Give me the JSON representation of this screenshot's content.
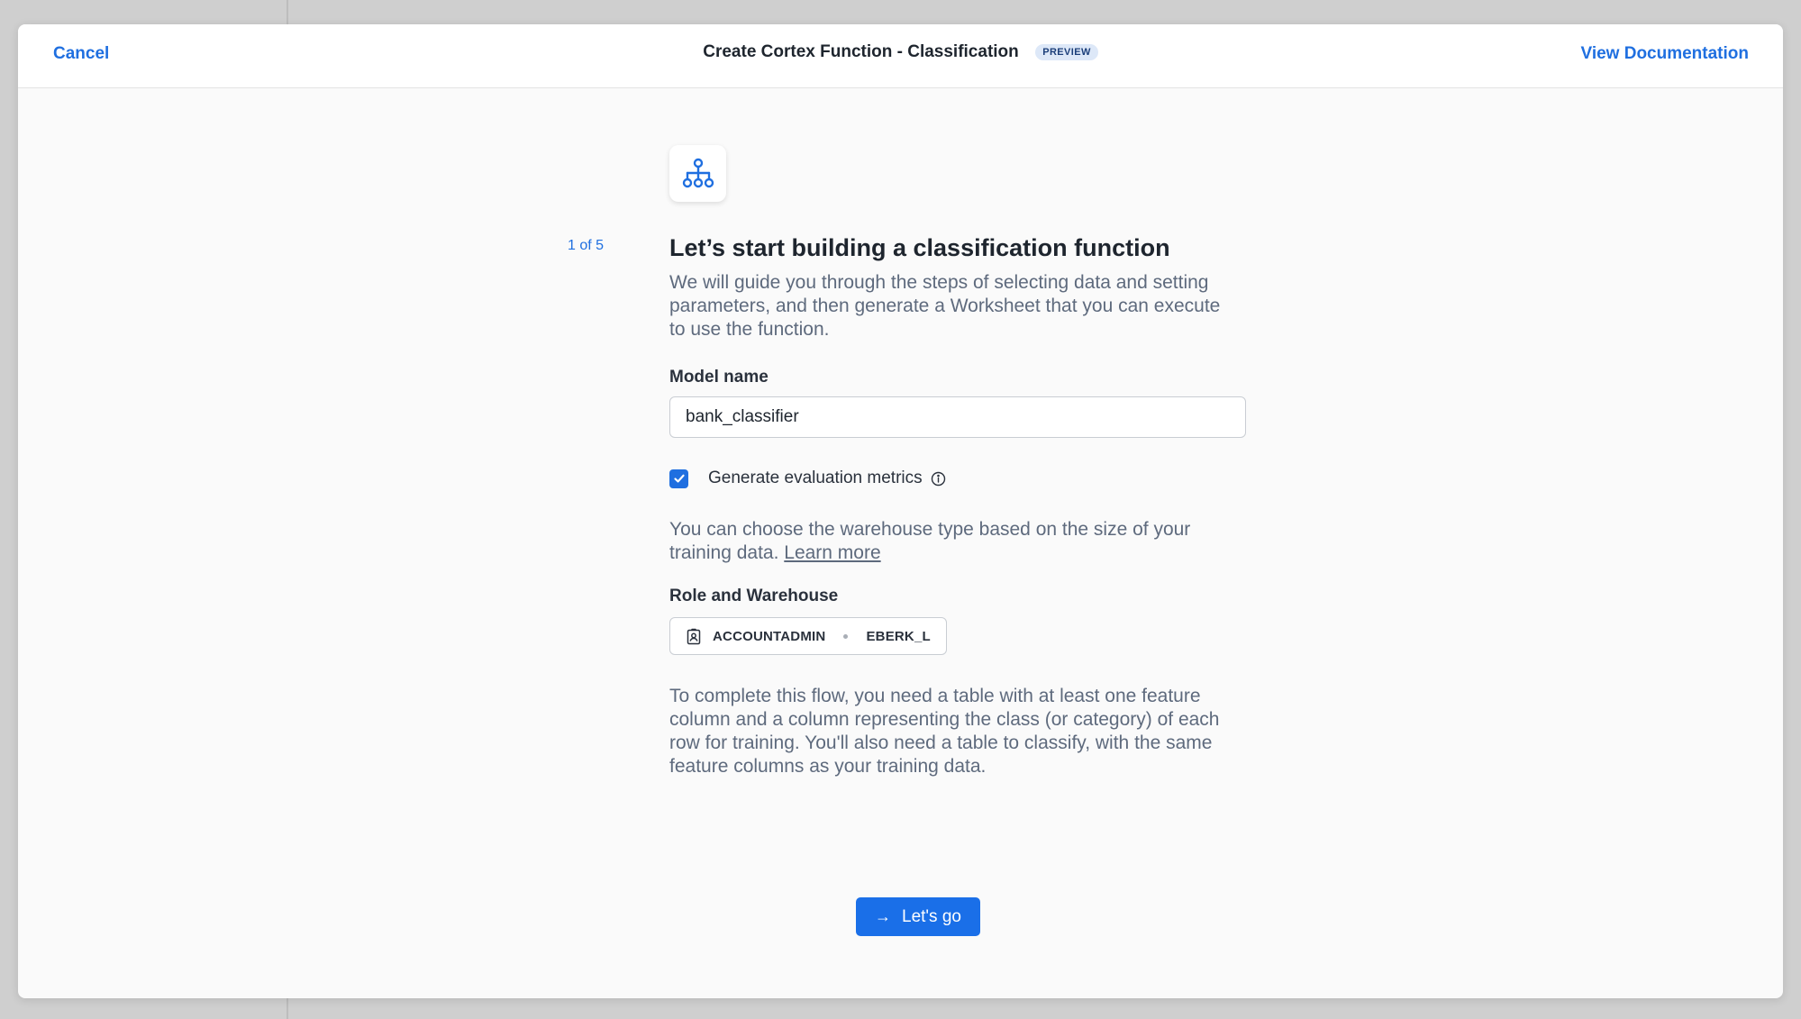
{
  "header": {
    "cancel_label": "Cancel",
    "title": "Create Cortex Function - Classification",
    "badge": "PREVIEW",
    "docs_label": "View Documentation"
  },
  "step": {
    "counter": "1 of 5",
    "icon": "hierarchy-icon",
    "heading": "Let’s start building a classification function",
    "intro": "We will guide you through the steps of selecting data and setting parameters, and then generate a Worksheet that you can execute to use the function."
  },
  "form": {
    "model_name_label": "Model name",
    "model_name_value": "bank_classifier",
    "eval_metrics_label": "Generate evaluation metrics",
    "eval_metrics_checked": true,
    "warehouse_note": "You can choose the warehouse type based on the size of your training data.",
    "learn_more_label": "Learn more",
    "role_warehouse_label": "Role and Warehouse",
    "role": "ACCOUNTADMIN",
    "warehouse": "EBERK_L",
    "requirements": "To complete this flow, you need a table with at least one feature column and a column representing the class (or category) of each row for training. You'll also need a table to classify, with the same feature columns as your training data."
  },
  "actions": {
    "go_arrow": "→",
    "go_label": "Let's go"
  },
  "colors": {
    "accent": "#1f6fe0",
    "button": "#1a6fe8",
    "badge_bg": "#dde8f8"
  }
}
